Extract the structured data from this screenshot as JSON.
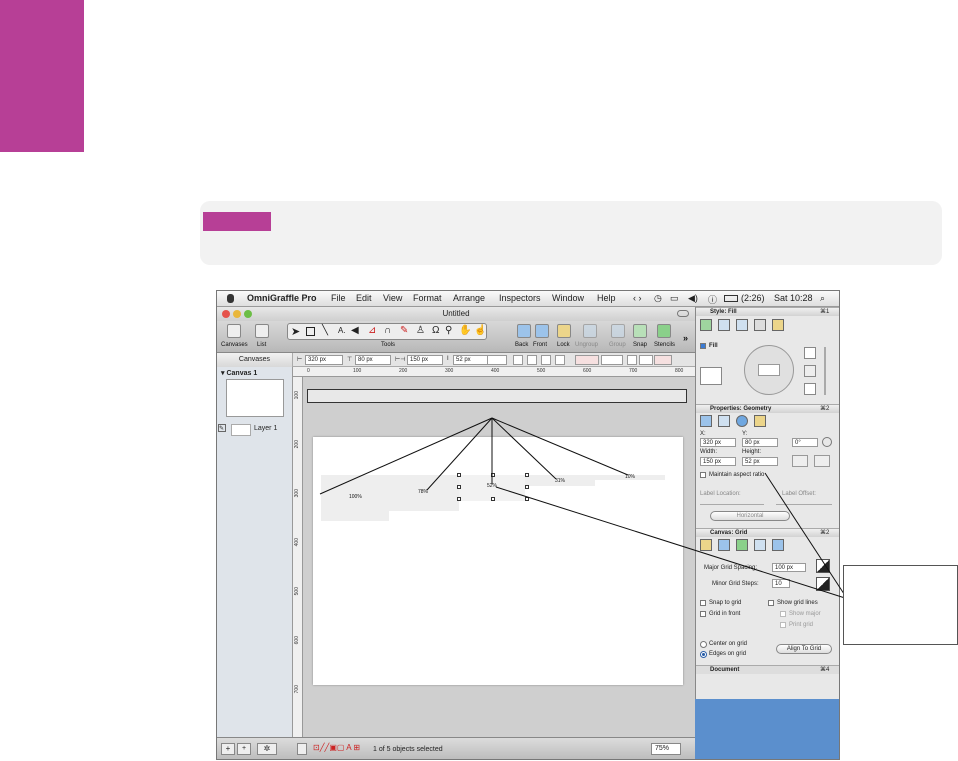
{
  "menubar": {
    "apple": "",
    "app_name": "OmniGraffle Pro",
    "items": [
      "File",
      "Edit",
      "View",
      "Format",
      "Arrange",
      "Inspectors",
      "Window",
      "Help"
    ],
    "battery": "(2:26)",
    "clock": "Sat 10:28"
  },
  "window": {
    "title": "Untitled"
  },
  "toolbar": {
    "canvases": "Canvases",
    "list": "List",
    "tools": "Tools",
    "back": "Back",
    "front": "Front",
    "lock": "Lock",
    "ungroup": "Ungroup",
    "group": "Group",
    "snap": "Snap",
    "stencils": "Stencils",
    "more": "»"
  },
  "geometry_bar": {
    "x": "320 px",
    "y": "80 px",
    "width": "150 px",
    "height": "52 px"
  },
  "sidebar": {
    "header": "Canvases",
    "canvas_name": "Canvas 1",
    "layer_name": "Layer 1"
  },
  "ruler": {
    "top_ticks": [
      "0",
      "100",
      "200",
      "300",
      "400",
      "500",
      "600",
      "700",
      "800"
    ],
    "left_ticks": [
      "100",
      "200",
      "300",
      "400",
      "500",
      "600",
      "700"
    ]
  },
  "chart_marks": {
    "labels": [
      "100%",
      "78%",
      "52%",
      "31%",
      "10%"
    ]
  },
  "statusbar": {
    "selection": "1 of 5 objects selected",
    "zoom": "75%"
  },
  "inspector": {
    "style_header": "Style: Fill",
    "fill_label": "Fill",
    "properties_header": "Properties: Geometry",
    "x_label": "X:",
    "y_label": "Y:",
    "x_value": "320 px",
    "y_value": "80 px",
    "rotation": "0°",
    "width_label": "Width:",
    "height_label": "Height:",
    "width_value": "150 px",
    "height_value": "52 px",
    "maintain_aspect": "Maintain aspect ratio",
    "label_location": "Label Location:",
    "label_offset": "Label Offset:",
    "orientation": "Horizontal",
    "canvas_grid_header": "Canvas: Grid",
    "major_grid_label": "Major Grid Spacing:",
    "major_grid_value": "100 px",
    "minor_grid_label": "Minor Grid Steps:",
    "minor_grid_value": "10",
    "snap_to_grid": "Snap to grid",
    "show_grid_lines": "Show grid lines",
    "grid_in_front": "Grid in front",
    "show_major": "Show major",
    "print_grid": "Print grid",
    "center_on_grid": "Center on grid",
    "edges_on_grid": "Edges on grid",
    "align_to_grid": "Align To Grid",
    "document_header": "Document",
    "shortcut_1": "⌘1",
    "shortcut_2": "⌘2",
    "shortcut_4": "⌘4"
  },
  "colors": {
    "accent_magenta": "#b73f96",
    "desktop_blue": "#5b8fcd"
  }
}
